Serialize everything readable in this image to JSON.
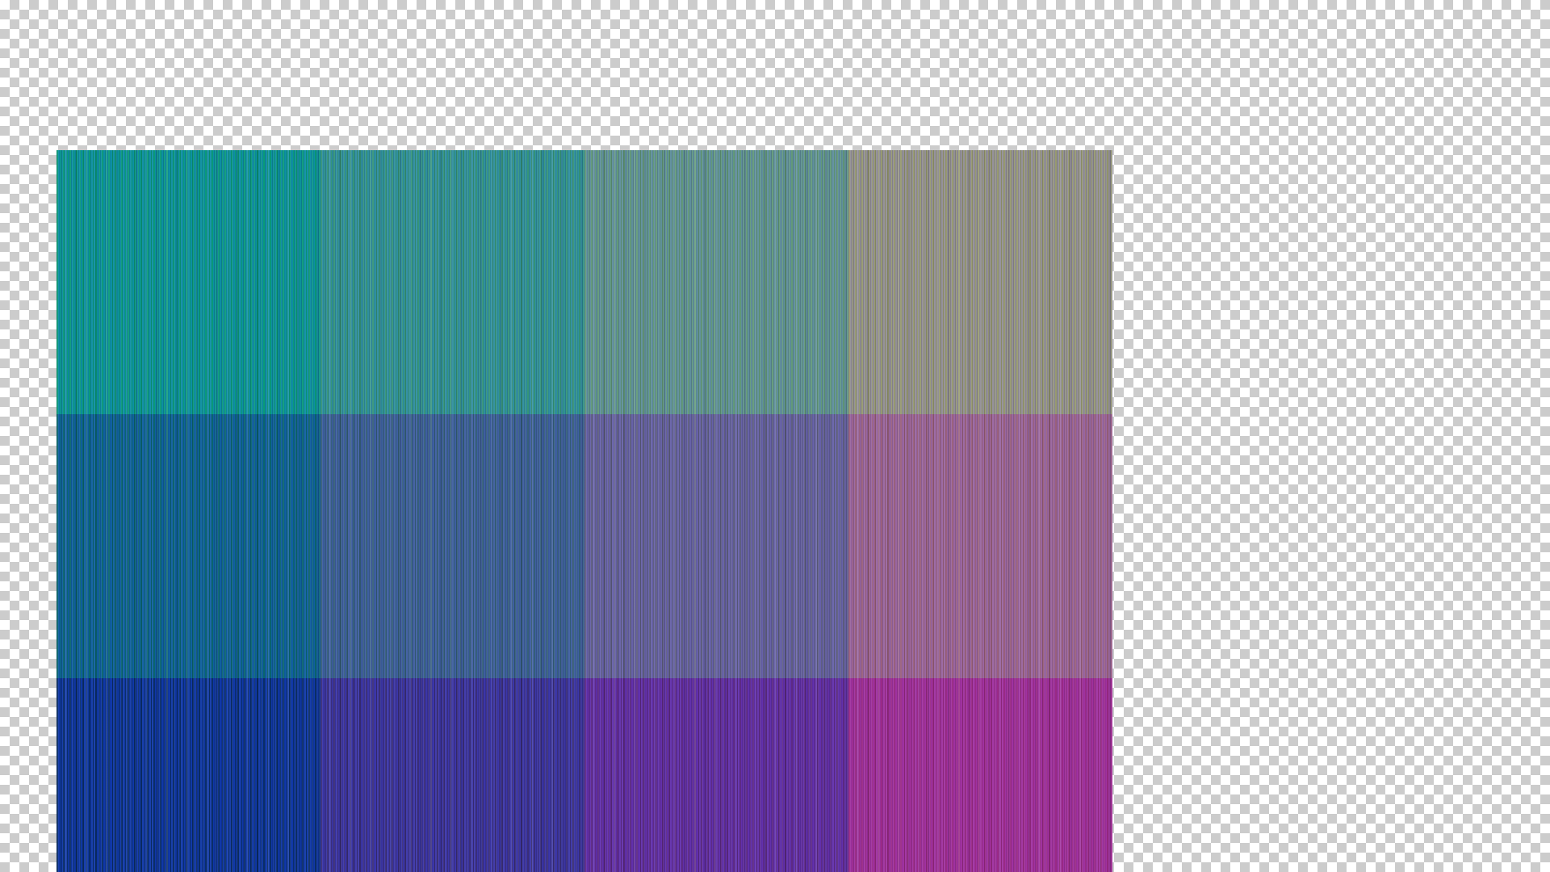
{
  "canvas": {
    "rows": 3,
    "cols": 4,
    "cells": [
      [
        {
          "color_a": "#0a9a7a",
          "color_b": "#0d8fa3"
        },
        {
          "color_a": "#35957a",
          "color_b": "#2f8fa0"
        },
        {
          "color_a": "#629a7a",
          "color_b": "#5f8f9c"
        },
        {
          "color_a": "#979a70",
          "color_b": "#928f96"
        }
      ],
      [
        {
          "color_a": "#0a6570",
          "color_b": "#1060a0"
        },
        {
          "color_a": "#36607c",
          "color_b": "#3e5fa0"
        },
        {
          "color_a": "#5f5f82",
          "color_b": "#6762a8"
        },
        {
          "color_a": "#9a607c",
          "color_b": "#9a66a0"
        }
      ],
      [
        {
          "color_a": "#0a2e6a",
          "color_b": "#1038a8"
        },
        {
          "color_a": "#3a2e7a",
          "color_b": "#3c36a8"
        },
        {
          "color_a": "#5e2a86",
          "color_b": "#6230ac"
        },
        {
          "color_a": "#9a2a86",
          "color_b": "#a032a0"
        }
      ]
    ]
  }
}
